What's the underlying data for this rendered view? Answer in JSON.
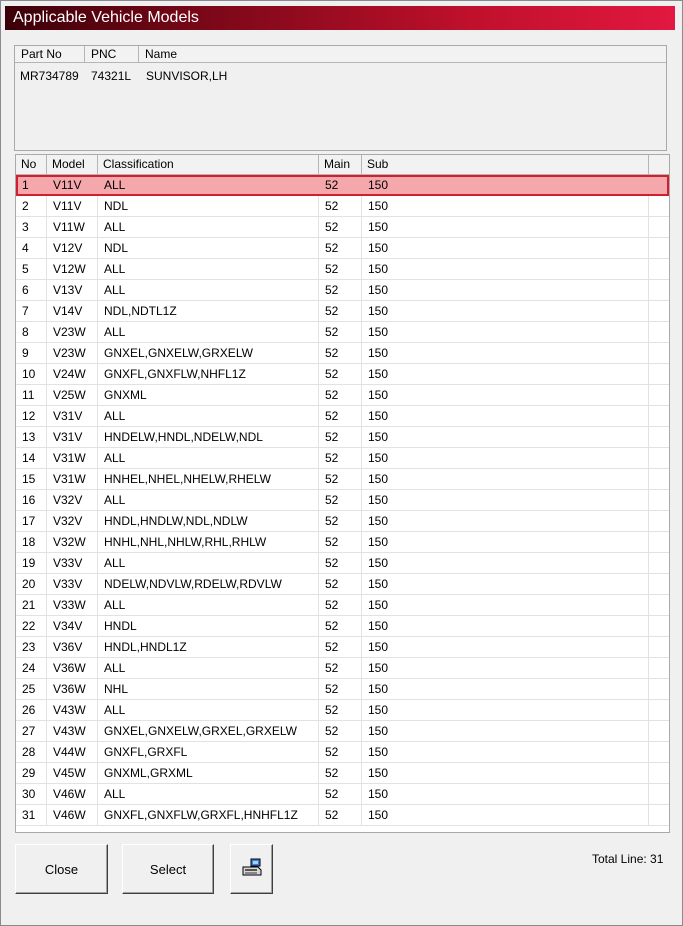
{
  "window": {
    "title": "Applicable Vehicle Models"
  },
  "part": {
    "headers": {
      "part_no": "Part No",
      "pnc": "PNC",
      "name": "Name"
    },
    "values": {
      "part_no": "MR734789",
      "pnc": "74321L",
      "name": "SUNVISOR,LH"
    }
  },
  "table": {
    "headers": {
      "no": "No",
      "model": "Model",
      "classification": "Classification",
      "main": "Main",
      "sub": "Sub"
    },
    "selected_index": 0,
    "rows": [
      {
        "no": "1",
        "model": "V11V",
        "classification": "ALL",
        "main": "52",
        "sub": "150"
      },
      {
        "no": "2",
        "model": "V11V",
        "classification": "NDL",
        "main": "52",
        "sub": "150"
      },
      {
        "no": "3",
        "model": "V11W",
        "classification": "ALL",
        "main": "52",
        "sub": "150"
      },
      {
        "no": "4",
        "model": "V12V",
        "classification": "NDL",
        "main": "52",
        "sub": "150"
      },
      {
        "no": "5",
        "model": "V12W",
        "classification": "ALL",
        "main": "52",
        "sub": "150"
      },
      {
        "no": "6",
        "model": "V13V",
        "classification": "ALL",
        "main": "52",
        "sub": "150"
      },
      {
        "no": "7",
        "model": "V14V",
        "classification": "NDL,NDTL1Z",
        "main": "52",
        "sub": "150"
      },
      {
        "no": "8",
        "model": "V23W",
        "classification": "ALL",
        "main": "52",
        "sub": "150"
      },
      {
        "no": "9",
        "model": "V23W",
        "classification": "GNXEL,GNXELW,GRXELW",
        "main": "52",
        "sub": "150"
      },
      {
        "no": "10",
        "model": "V24W",
        "classification": "GNXFL,GNXFLW,NHFL1Z",
        "main": "52",
        "sub": "150"
      },
      {
        "no": "11",
        "model": "V25W",
        "classification": "GNXML",
        "main": "52",
        "sub": "150"
      },
      {
        "no": "12",
        "model": "V31V",
        "classification": "ALL",
        "main": "52",
        "sub": "150"
      },
      {
        "no": "13",
        "model": "V31V",
        "classification": "HNDELW,HNDL,NDELW,NDL",
        "main": "52",
        "sub": "150"
      },
      {
        "no": "14",
        "model": "V31W",
        "classification": "ALL",
        "main": "52",
        "sub": "150"
      },
      {
        "no": "15",
        "model": "V31W",
        "classification": "HNHEL,NHEL,NHELW,RHELW",
        "main": "52",
        "sub": "150"
      },
      {
        "no": "16",
        "model": "V32V",
        "classification": "ALL",
        "main": "52",
        "sub": "150"
      },
      {
        "no": "17",
        "model": "V32V",
        "classification": "HNDL,HNDLW,NDL,NDLW",
        "main": "52",
        "sub": "150"
      },
      {
        "no": "18",
        "model": "V32W",
        "classification": "HNHL,NHL,NHLW,RHL,RHLW",
        "main": "52",
        "sub": "150"
      },
      {
        "no": "19",
        "model": "V33V",
        "classification": "ALL",
        "main": "52",
        "sub": "150"
      },
      {
        "no": "20",
        "model": "V33V",
        "classification": "NDELW,NDVLW,RDELW,RDVLW",
        "main": "52",
        "sub": "150"
      },
      {
        "no": "21",
        "model": "V33W",
        "classification": "ALL",
        "main": "52",
        "sub": "150"
      },
      {
        "no": "22",
        "model": "V34V",
        "classification": "HNDL",
        "main": "52",
        "sub": "150"
      },
      {
        "no": "23",
        "model": "V36V",
        "classification": "HNDL,HNDL1Z",
        "main": "52",
        "sub": "150"
      },
      {
        "no": "24",
        "model": "V36W",
        "classification": "ALL",
        "main": "52",
        "sub": "150"
      },
      {
        "no": "25",
        "model": "V36W",
        "classification": "NHL",
        "main": "52",
        "sub": "150"
      },
      {
        "no": "26",
        "model": "V43W",
        "classification": "ALL",
        "main": "52",
        "sub": "150"
      },
      {
        "no": "27",
        "model": "V43W",
        "classification": "GNXEL,GNXELW,GRXEL,GRXELW",
        "main": "52",
        "sub": "150"
      },
      {
        "no": "28",
        "model": "V44W",
        "classification": "GNXFL,GRXFL",
        "main": "52",
        "sub": "150"
      },
      {
        "no": "29",
        "model": "V45W",
        "classification": "GNXML,GRXML",
        "main": "52",
        "sub": "150"
      },
      {
        "no": "30",
        "model": "V46W",
        "classification": "ALL",
        "main": "52",
        "sub": "150"
      },
      {
        "no": "31",
        "model": "V46W",
        "classification": "GNXFL,GNXFLW,GRXFL,HNHFL1Z",
        "main": "52",
        "sub": "150"
      }
    ]
  },
  "buttons": {
    "close": "Close",
    "select": "Select",
    "print_icon": "printer-icon"
  },
  "footer": {
    "total_line": "Total Line: 31"
  }
}
